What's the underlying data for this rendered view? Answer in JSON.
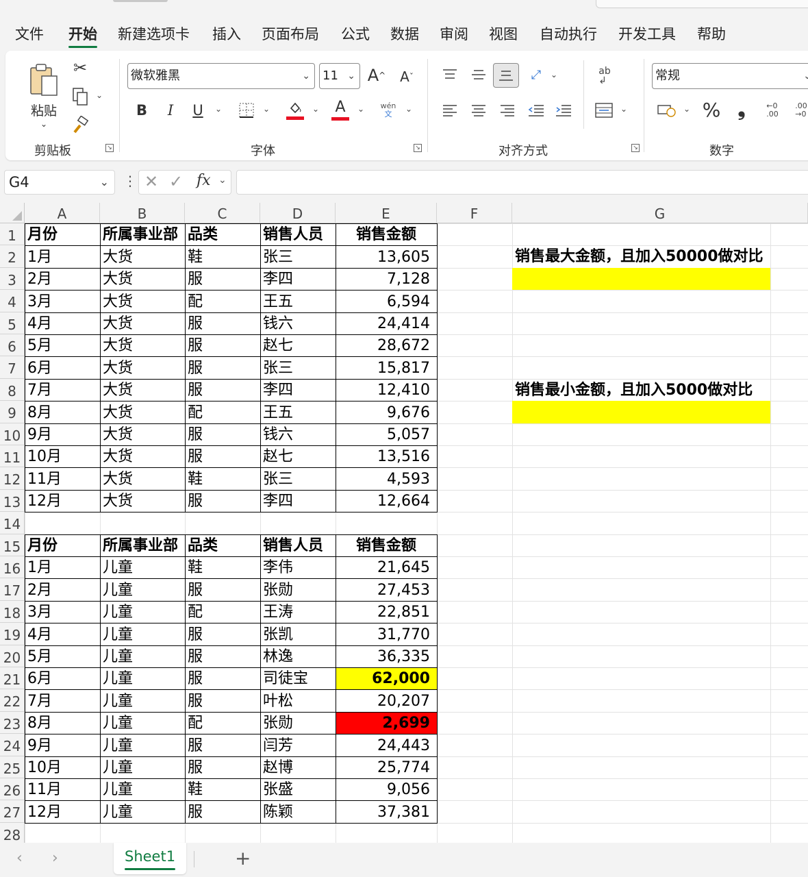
{
  "menu": {
    "tabs": [
      "文件",
      "开始",
      "新建选项卡",
      "插入",
      "页面布局",
      "公式",
      "数据",
      "审阅",
      "视图",
      "自动执行",
      "开发工具",
      "帮助"
    ],
    "active": "开始"
  },
  "ribbon": {
    "clipboard": {
      "paste_label": "粘贴",
      "group_label": "剪贴板"
    },
    "font": {
      "font_name": "微软雅黑",
      "font_size": "11",
      "group_label": "字体",
      "bold": "B",
      "italic": "I",
      "underline": "U",
      "font_color_glyph": "A",
      "phonetic_top": "wén",
      "phonetic_bottom": "文"
    },
    "alignment": {
      "group_label": "对齐方式"
    },
    "number": {
      "format": "常规",
      "group_label": "数字",
      "percent": "%",
      "comma": "❟"
    }
  },
  "formula_bar": {
    "name_box": "G4",
    "fx": "fx",
    "formula": ""
  },
  "columns": [
    "A",
    "B",
    "C",
    "D",
    "E",
    "F",
    "G"
  ],
  "headers": [
    "月份",
    "所属事业部",
    "品类",
    "销售人员",
    "销售金额"
  ],
  "table1": [
    [
      "1月",
      "大货",
      "鞋",
      "张三",
      "13,605"
    ],
    [
      "2月",
      "大货",
      "服",
      "李四",
      "7,128"
    ],
    [
      "3月",
      "大货",
      "配",
      "王五",
      "6,594"
    ],
    [
      "4月",
      "大货",
      "服",
      "钱六",
      "24,414"
    ],
    [
      "5月",
      "大货",
      "服",
      "赵七",
      "28,672"
    ],
    [
      "6月",
      "大货",
      "服",
      "张三",
      "15,817"
    ],
    [
      "7月",
      "大货",
      "服",
      "李四",
      "12,410"
    ],
    [
      "8月",
      "大货",
      "配",
      "王五",
      "9,676"
    ],
    [
      "9月",
      "大货",
      "服",
      "钱六",
      "5,057"
    ],
    [
      "10月",
      "大货",
      "服",
      "赵七",
      "13,516"
    ],
    [
      "11月",
      "大货",
      "鞋",
      "张三",
      "4,593"
    ],
    [
      "12月",
      "大货",
      "服",
      "李四",
      "12,664"
    ]
  ],
  "table2": [
    [
      "1月",
      "儿童",
      "鞋",
      "李伟",
      "21,645"
    ],
    [
      "2月",
      "儿童",
      "服",
      "张勋",
      "27,453"
    ],
    [
      "3月",
      "儿童",
      "配",
      "王涛",
      "22,851"
    ],
    [
      "4月",
      "儿童",
      "服",
      "张凯",
      "31,770"
    ],
    [
      "5月",
      "儿童",
      "服",
      "林逸",
      "36,335"
    ],
    [
      "6月",
      "儿童",
      "服",
      "司徒宝",
      "62,000"
    ],
    [
      "7月",
      "儿童",
      "服",
      "叶松",
      "20,207"
    ],
    [
      "8月",
      "儿童",
      "配",
      "张勋",
      "2,699"
    ],
    [
      "9月",
      "儿童",
      "服",
      "闫芳",
      "24,443"
    ],
    [
      "10月",
      "儿童",
      "服",
      "赵博",
      "25,774"
    ],
    [
      "11月",
      "儿童",
      "鞋",
      "张盛",
      "9,056"
    ],
    [
      "12月",
      "儿童",
      "服",
      "陈颖",
      "37,381"
    ]
  ],
  "notes": {
    "max_label": "销售最大金额，且加入50000做对比",
    "min_label": "销售最小金额，且加入5000做对比"
  },
  "highlights": {
    "max_fill": "#ffff00",
    "min_fill": "#ff0000",
    "accent": "#107c41"
  },
  "sheets": {
    "tabs": [
      "Sheet1"
    ],
    "active": "Sheet1",
    "add": "+"
  }
}
